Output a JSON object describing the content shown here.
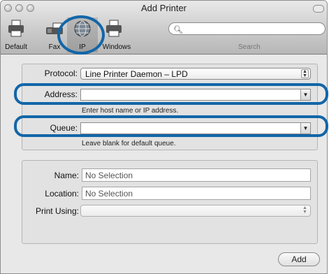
{
  "window": {
    "title": "Add Printer"
  },
  "toolbar": {
    "items": [
      {
        "label": "Default",
        "icon": "default-printer-icon"
      },
      {
        "label": "Fax",
        "icon": "fax-icon"
      },
      {
        "label": "IP",
        "icon": "globe-icon",
        "selected": true
      },
      {
        "label": "Windows",
        "icon": "windows-printer-icon"
      }
    ],
    "search_label": "Search"
  },
  "form": {
    "protocol_label": "Protocol:",
    "protocol_value": "Line Printer Daemon – LPD",
    "address_label": "Address:",
    "address_value": "",
    "address_hint": "Enter host name or IP address.",
    "queue_label": "Queue:",
    "queue_value": "",
    "queue_hint": "Leave blank for default queue."
  },
  "details": {
    "name_label": "Name:",
    "name_value": "No Selection",
    "location_label": "Location:",
    "location_value": "No Selection",
    "print_using_label": "Print Using:",
    "print_using_value": ""
  },
  "actions": {
    "add_label": "Add"
  },
  "colors": {
    "highlight": "#1266a8"
  }
}
